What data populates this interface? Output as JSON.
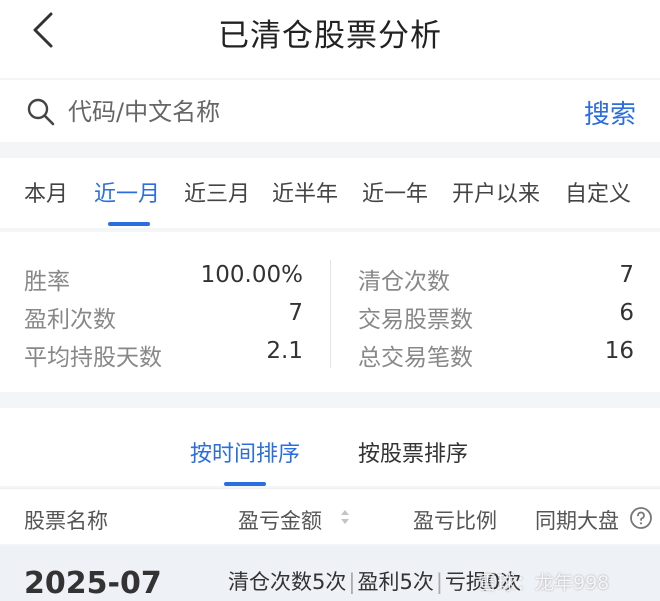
{
  "header": {
    "title": "已清仓股票分析"
  },
  "search": {
    "placeholder": "代码/中文名称",
    "button_label": "搜索"
  },
  "period_tabs": [
    {
      "label": "本月"
    },
    {
      "label": "近一月",
      "active": true
    },
    {
      "label": "近三月"
    },
    {
      "label": "近半年"
    },
    {
      "label": "近一年"
    },
    {
      "label": "开户以来"
    },
    {
      "label": "自定义"
    }
  ],
  "stats": {
    "win_rate": {
      "label": "胜率",
      "value": "100.00%"
    },
    "profit_count": {
      "label": "盈利次数",
      "value": "7"
    },
    "avg_hold_days": {
      "label": "平均持股天数",
      "value": "2.1"
    },
    "clear_count": {
      "label": "清仓次数",
      "value": "7"
    },
    "traded_stocks": {
      "label": "交易股票数",
      "value": "6"
    },
    "total_trades": {
      "label": "总交易笔数",
      "value": "16"
    }
  },
  "sort_tabs": [
    {
      "label": "按时间排序",
      "active": true
    },
    {
      "label": "按股票排序"
    }
  ],
  "table": {
    "headers": [
      "股票名称",
      "盈亏金额",
      "盈亏比例",
      "同期大盘"
    ]
  },
  "month_group": {
    "month": "2025-07",
    "clear_count": "清仓次数5次",
    "profit": "盈利5次",
    "loss": "亏损0次"
  },
  "watermark": "雪球：龙年998",
  "colors": {
    "accent": "#2a6ee0",
    "background": "#f4f5f7",
    "group_bg": "#eef1f6"
  }
}
